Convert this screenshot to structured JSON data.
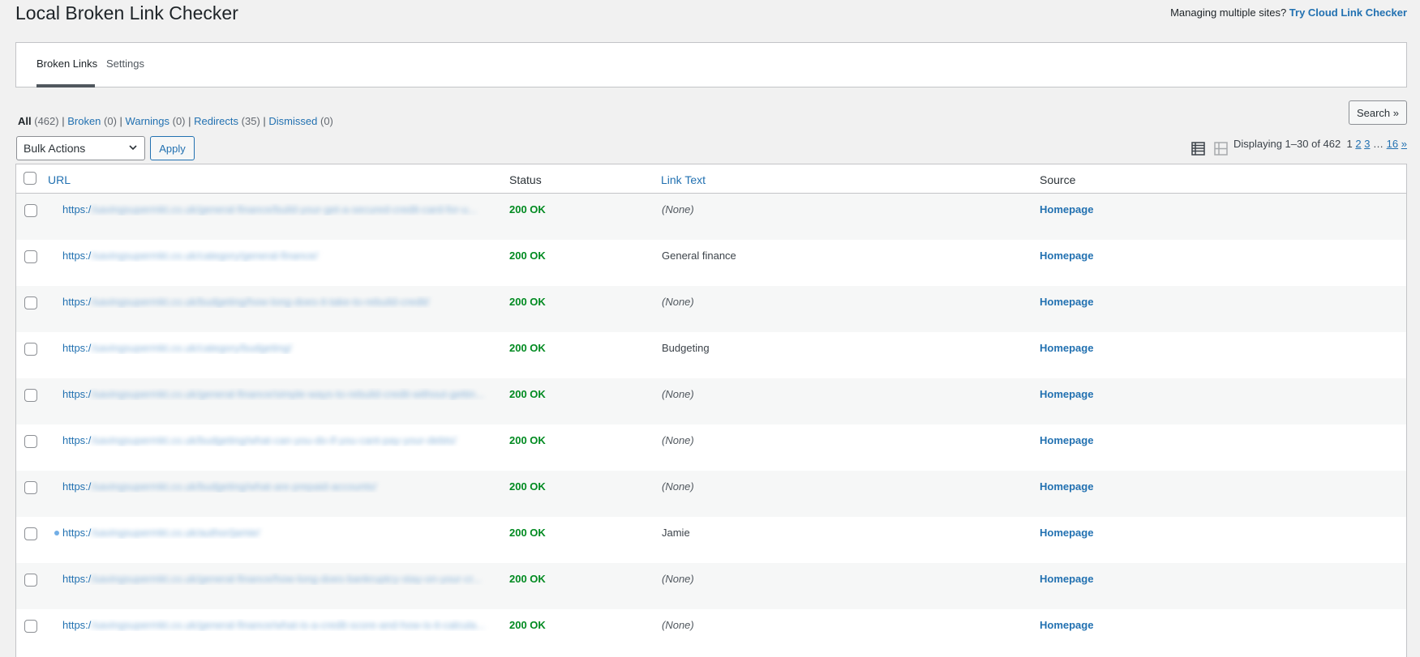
{
  "header": {
    "title": "Local Broken Link Checker",
    "promo_text": "Managing multiple sites?",
    "promo_link": "Try Cloud Link Checker"
  },
  "tabs": [
    {
      "label": "Broken Links",
      "active": true
    },
    {
      "label": "Settings",
      "active": false
    }
  ],
  "filters": [
    {
      "label": "All",
      "count": "(462)"
    },
    {
      "label": "Broken",
      "count": "(0)"
    },
    {
      "label": "Warnings",
      "count": "(0)"
    },
    {
      "label": "Redirects",
      "count": "(35)"
    },
    {
      "label": "Dismissed",
      "count": "(0)"
    }
  ],
  "search": {
    "label": "Search »"
  },
  "bulk_actions": {
    "selected": "Bulk Actions",
    "apply_label": "Apply"
  },
  "pagination": {
    "displaying": "Displaying 1–30 of 462",
    "current": "1",
    "p2": "2",
    "p3": "3",
    "ellipsis": "…",
    "last": "16",
    "next": "»"
  },
  "columns": {
    "url": "URL",
    "status": "Status",
    "link_text": "Link Text",
    "source": "Source"
  },
  "rows": [
    {
      "url_prefix": "https:/",
      "url_rest": "/savingsupermkt.co.uk/general-finance/build-your-get-a-secured-credit-card-for-u...",
      "status": "200 OK",
      "link_text": "(None)",
      "source": "Homepage"
    },
    {
      "url_prefix": "https:/",
      "url_rest": "/savingsupermkt.co.uk/category/general-finance/",
      "status": "200 OK",
      "link_text": "General finance",
      "source": "Homepage"
    },
    {
      "url_prefix": "https:/",
      "url_rest": "/savingsupermkt.co.uk/budgeting/how-long-does-it-take-to-rebuild-credit/",
      "status": "200 OK",
      "link_text": "(None)",
      "source": "Homepage"
    },
    {
      "url_prefix": "https:/",
      "url_rest": "/savingsupermkt.co.uk/category/budgeting/",
      "status": "200 OK",
      "link_text": "Budgeting",
      "source": "Homepage"
    },
    {
      "url_prefix": "https:/",
      "url_rest": "/savingsupermkt.co.uk/general-finance/simple-ways-to-rebuild-credit-without-gettin...",
      "status": "200 OK",
      "link_text": "(None)",
      "source": "Homepage"
    },
    {
      "url_prefix": "https:/",
      "url_rest": "/savingsupermkt.co.uk/budgeting/what-can-you-do-if-you-cant-pay-your-debts/",
      "status": "200 OK",
      "link_text": "(None)",
      "source": "Homepage"
    },
    {
      "url_prefix": "https:/",
      "url_rest": "/savingsupermkt.co.uk/budgeting/what-are-prepaid-accounts/",
      "status": "200 OK",
      "link_text": "(None)",
      "source": "Homepage"
    },
    {
      "url_prefix": "https:/",
      "url_rest": "/savingsupermkt.co.uk/author/jamie/",
      "status": "200 OK",
      "link_text": "Jamie",
      "source": "Homepage"
    },
    {
      "url_prefix": "https:/",
      "url_rest": "/savingsupermkt.co.uk/general-finance/how-long-does-bankruptcy-stay-on-your-cr...",
      "status": "200 OK",
      "link_text": "(None)",
      "source": "Homepage"
    },
    {
      "url_prefix": "https:/",
      "url_rest": "/savingsupermkt.co.uk/general-finance/what-is-a-credit-score-and-how-is-it-calcula...",
      "status": "200 OK",
      "link_text": "(None)",
      "source": "Homepage"
    }
  ],
  "colors": {
    "accent": "#2271b1",
    "ok": "#008a20"
  },
  "icons": {
    "list_view": "list-view-icon",
    "excerpt_view": "excerpt-view-icon"
  }
}
